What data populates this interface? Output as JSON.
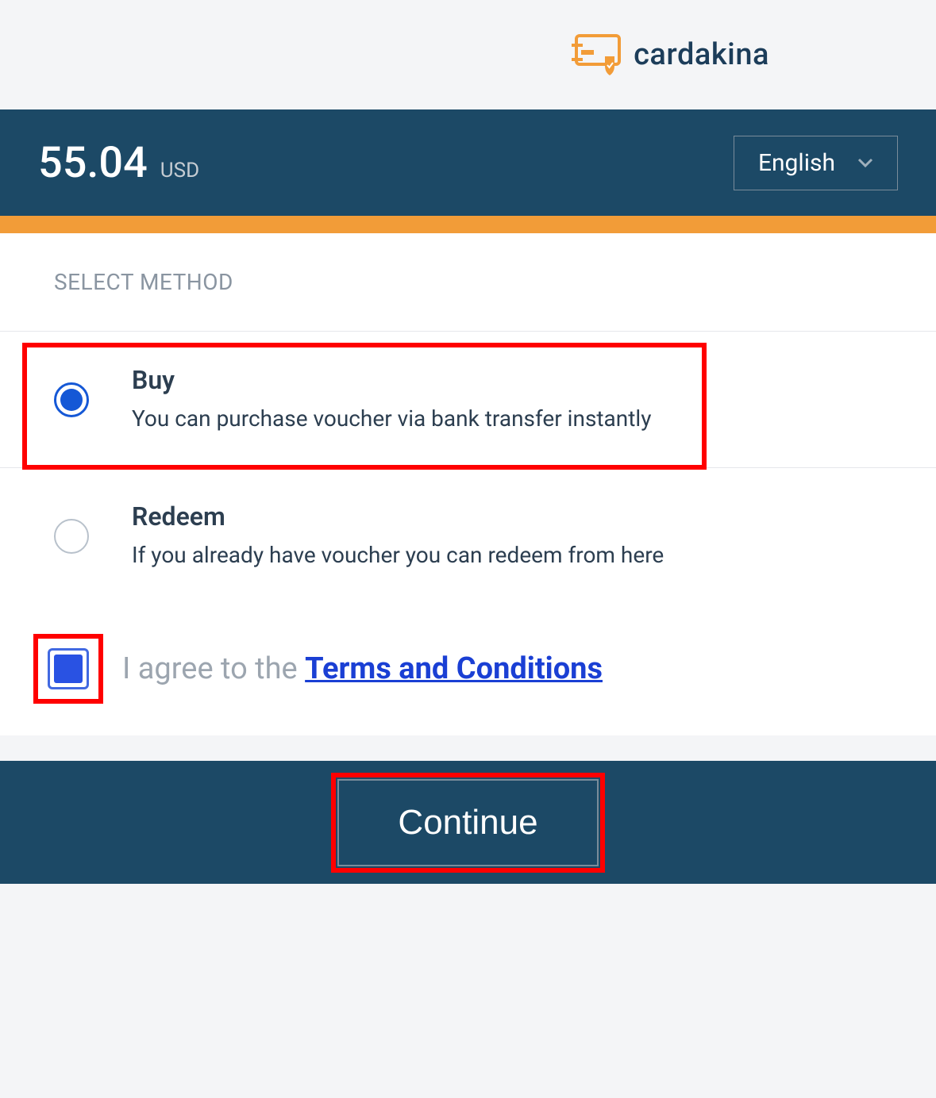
{
  "logo": {
    "text": "cardakina"
  },
  "header": {
    "amount": "55.04",
    "currency": "USD",
    "language": "English"
  },
  "section": {
    "title": "SELECT METHOD"
  },
  "methods": [
    {
      "title": "Buy",
      "desc": "You can purchase voucher via bank transfer instantly",
      "selected": true
    },
    {
      "title": "Redeem",
      "desc": "If you already have voucher you can redeem from here",
      "selected": false
    }
  ],
  "terms": {
    "prefix": "I agree to the ",
    "link": "Terms and Conditions"
  },
  "footer": {
    "continue": "Continue"
  }
}
